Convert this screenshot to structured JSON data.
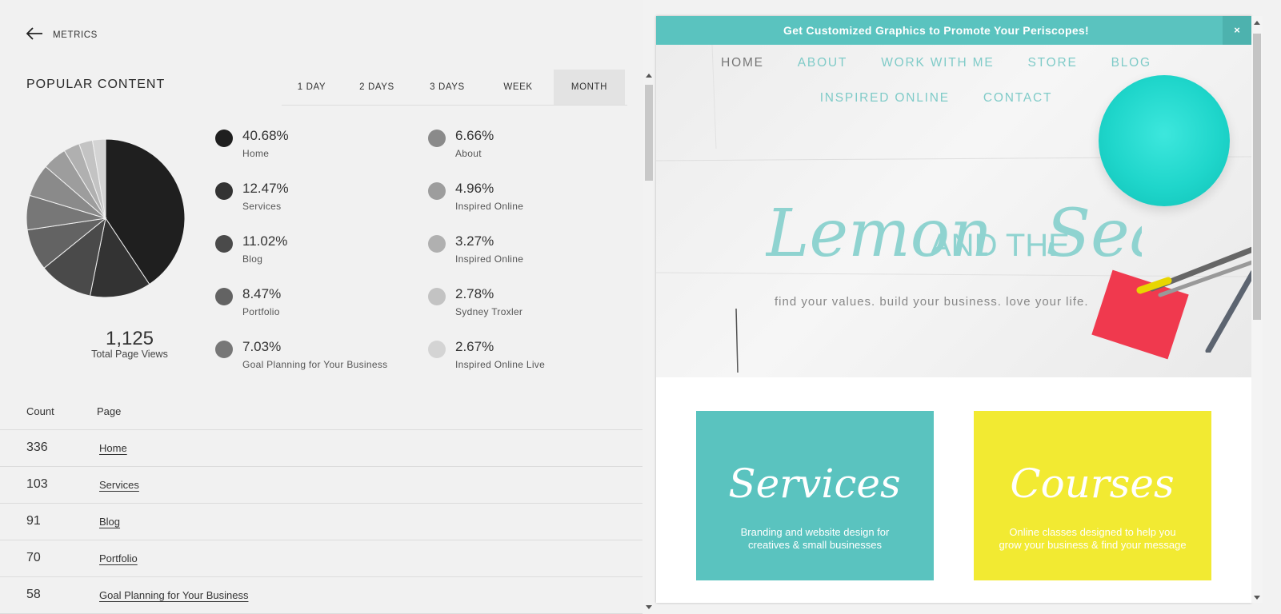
{
  "header": {
    "back_label": "METRICS"
  },
  "section_title": "POPULAR CONTENT",
  "tabs": [
    {
      "label": "1 DAY",
      "active": false
    },
    {
      "label": "2 DAYS",
      "active": false
    },
    {
      "label": "3 DAYS",
      "active": false
    },
    {
      "label": "WEEK",
      "active": false
    },
    {
      "label": "MONTH",
      "active": true
    }
  ],
  "total": {
    "value": "1,125",
    "label": "Total Page Views"
  },
  "legend": [
    {
      "percent": "40.68%",
      "page": "Home",
      "color": "#1f1f1f"
    },
    {
      "percent": "12.47%",
      "page": "Services",
      "color": "#333333"
    },
    {
      "percent": "11.02%",
      "page": "Blog",
      "color": "#4a4a4a"
    },
    {
      "percent": "8.47%",
      "page": "Portfolio",
      "color": "#636363"
    },
    {
      "percent": "7.03%",
      "page": "Goal Planning for Your Business",
      "color": "#777777"
    },
    {
      "percent": "6.66%",
      "page": "About",
      "color": "#8a8a8a"
    },
    {
      "percent": "4.96%",
      "page": "Inspired Online",
      "color": "#9d9d9d"
    },
    {
      "percent": "3.27%",
      "page": "Inspired Online",
      "color": "#b0b0b0"
    },
    {
      "percent": "2.78%",
      "page": "Sydney Troxler",
      "color": "#c3c3c3"
    },
    {
      "percent": "2.67%",
      "page": "Inspired Online Live",
      "color": "#d4d4d4"
    }
  ],
  "chart_data": {
    "type": "pie",
    "categories": [
      "Home",
      "Services",
      "Blog",
      "Portfolio",
      "Goal Planning for Your Business",
      "About",
      "Inspired Online",
      "Inspired Online",
      "Sydney Troxler",
      "Inspired Online Live"
    ],
    "values": [
      40.68,
      12.47,
      11.02,
      8.47,
      7.03,
      6.66,
      4.96,
      3.27,
      2.78,
      2.67
    ],
    "colors": [
      "#1f1f1f",
      "#333333",
      "#4a4a4a",
      "#636363",
      "#777777",
      "#8a8a8a",
      "#9d9d9d",
      "#b0b0b0",
      "#c3c3c3",
      "#d4d4d4"
    ]
  },
  "table": {
    "headers": {
      "count": "Count",
      "page": "Page"
    },
    "rows": [
      {
        "count": "336",
        "page": "Home"
      },
      {
        "count": "103",
        "page": "Services"
      },
      {
        "count": "91",
        "page": "Blog"
      },
      {
        "count": "70",
        "page": "Portfolio"
      },
      {
        "count": "58",
        "page": "Goal Planning for Your Business"
      }
    ]
  },
  "preview": {
    "banner_text": "Get Customized Graphics to Promote Your Periscopes!",
    "banner_close": "×",
    "nav_row1": [
      "HOME",
      "ABOUT",
      "WORK WITH ME",
      "STORE",
      "BLOG"
    ],
    "nav_row2": [
      "INSPIRED ONLINE",
      "CONTACT"
    ],
    "logo": {
      "part1": "Lemon",
      "part2": "AND THE",
      "part3": "Sea"
    },
    "tagline": "find your values. build your business. love your life.",
    "cards": [
      {
        "title": "Services",
        "desc": "Branding and website design for creatives & small businesses"
      },
      {
        "title": "Courses",
        "desc": "Online classes designed to help you grow your business & find your message"
      }
    ]
  },
  "colors": {
    "teal": "#5ac3bf",
    "yellow": "#f2ea32",
    "bowl": "#1fd6cb",
    "sticky": "#f0394e"
  }
}
